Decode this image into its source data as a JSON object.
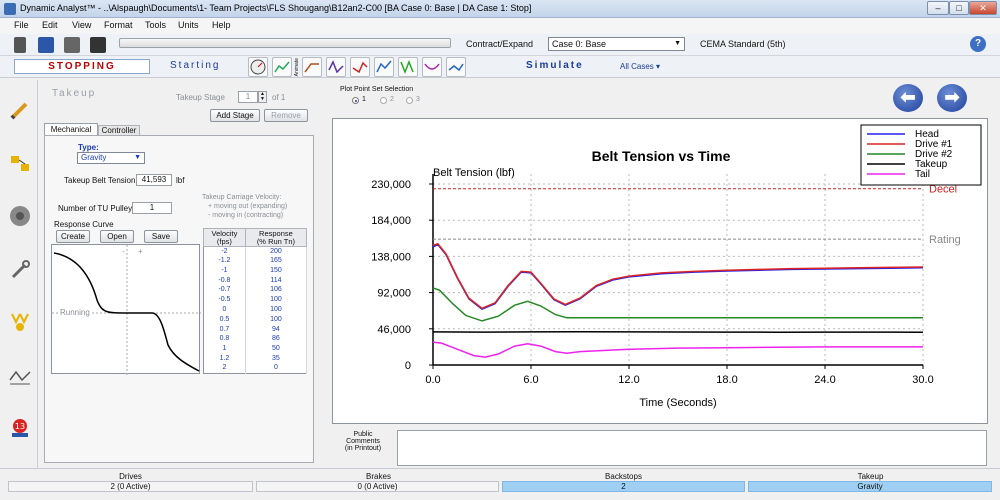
{
  "window": {
    "title": "Dynamic Analyst™ - ..\\Alspaugh\\Documents\\1- Team Projects\\FLS Shougang\\B12an2-C00 [BA Case 0: Base | DA Case 1: Stop]",
    "min": "–",
    "max": "□",
    "close": "✕"
  },
  "menu": [
    "File",
    "Edit",
    "View",
    "Format",
    "Tools",
    "Units",
    "Help"
  ],
  "toolbar": {
    "contract_expand": "Contract/Expand",
    "case_select": "Case 0: Base",
    "standard": "CEMA Standard (5th)",
    "help": "?"
  },
  "modebar": {
    "stopping": "STOPPING",
    "starting": "Starting",
    "simulate": "Simulate",
    "all_cases": "All Cases ▾",
    "tools": [
      "Animate",
      "Tension",
      "Speed",
      "Power",
      "Torque",
      "Slip",
      "Takeup",
      "Sag"
    ]
  },
  "takeup": {
    "title": "Takeup",
    "stage_label": "Takeup Stage",
    "stage_value": "1",
    "stage_of": "of 1",
    "add_stage": "Add Stage",
    "remove": "Remove",
    "tabs": [
      "Mechanical",
      "Controller"
    ],
    "type_label": "Type:",
    "type_value": "Gravity",
    "belt_tension_label": "Takeup Belt Tension",
    "belt_tension_value": "41,593",
    "belt_tension_unit": "lbf",
    "pulleys_label": "Number of TU Pulleys",
    "pulleys_value": "1",
    "carriage_title": "Takeup Carriage Velocity:",
    "carriage_plus": "+  moving out (expanding)",
    "carriage_minus": "-   moving in (contracting)",
    "response_curve": "Response Curve",
    "create": "Create",
    "open": "Open",
    "save": "Save",
    "curve_minus": "-",
    "curve_plus": "+",
    "running": "Running",
    "table_headers": [
      "Velocity\n(fps)",
      "Response\n(% Run Tn)"
    ],
    "table_rows": [
      [
        "-2",
        "200"
      ],
      [
        "-1.2",
        "165"
      ],
      [
        "-1",
        "150"
      ],
      [
        "-0.8",
        "114"
      ],
      [
        "-0.7",
        "106"
      ],
      [
        "-0.5",
        "100"
      ],
      [
        "0",
        "100"
      ],
      [
        "0.5",
        "100"
      ],
      [
        "0.7",
        "94"
      ],
      [
        "0.8",
        "86"
      ],
      [
        "1",
        "50"
      ],
      [
        "1.2",
        "35"
      ],
      [
        "2",
        "0"
      ]
    ]
  },
  "plotpoint": {
    "label": "Plot Point Set Selection",
    "options": [
      "1",
      "2",
      "3"
    ]
  },
  "comments": {
    "label": "Public Comments\n(in Printout)"
  },
  "status": [
    {
      "head": "Drives",
      "value": "2 (0 Active)"
    },
    {
      "head": "Brakes",
      "value": "0 (0 Active)"
    },
    {
      "head": "Backstops",
      "value": "2"
    },
    {
      "head": "Takeup",
      "value": "Gravity"
    }
  ],
  "chart_data": {
    "type": "line",
    "title": "Belt Tension vs Time",
    "ylabel": "Belt Tension (lbf)",
    "xlabel": "Time (Seconds)",
    "xlim": [
      0,
      30
    ],
    "ylim": [
      0,
      230000
    ],
    "xticks": [
      "0.0",
      "6.0",
      "12.0",
      "18.0",
      "24.0",
      "30.0"
    ],
    "yticks": [
      "0",
      "46,000",
      "92,000",
      "138,000",
      "184,000",
      "230,000"
    ],
    "grid": true,
    "legend": "top-right",
    "reference_lines": [
      {
        "name": "Decel",
        "y": 224000,
        "color": "#cc2222"
      },
      {
        "name": "Rating",
        "y": 160000,
        "color": "#888888"
      }
    ],
    "series": [
      {
        "name": "Head",
        "color": "#2222ee",
        "x": [
          0,
          0.3,
          0.8,
          1.5,
          2.2,
          3,
          3.8,
          4.6,
          5.4,
          6,
          6.6,
          7.4,
          8.1,
          9,
          10,
          11,
          12,
          14,
          16,
          18,
          20,
          22,
          24,
          26,
          28,
          30
        ],
        "y": [
          150000,
          153000,
          140000,
          110000,
          84000,
          71000,
          78000,
          100000,
          118000,
          117000,
          103000,
          83000,
          76000,
          84000,
          100000,
          108000,
          112000,
          116000,
          118000,
          119500,
          120500,
          121500,
          122000,
          122500,
          123000,
          123500
        ]
      },
      {
        "name": "Drive #1",
        "color": "#dd2222",
        "x": [
          0,
          0.3,
          0.8,
          1.5,
          2.2,
          3,
          3.8,
          4.6,
          5.4,
          6,
          6.6,
          7.4,
          8.1,
          9,
          10,
          11,
          12,
          14,
          16,
          18,
          20,
          22,
          24,
          26,
          28,
          30
        ],
        "y": [
          152000,
          154000,
          141000,
          111000,
          85000,
          72000,
          79000,
          101000,
          119000,
          118000,
          104000,
          84000,
          77000,
          85000,
          101000,
          109000,
          113000,
          117000,
          119000,
          120500,
          121500,
          122500,
          123000,
          123500,
          124000,
          124500
        ]
      },
      {
        "name": "Drive #2",
        "color": "#228822",
        "x": [
          0,
          0.4,
          1.2,
          2,
          3,
          4,
          5,
          5.8,
          6.6,
          7.5,
          8.2,
          9,
          12,
          15,
          18,
          21,
          24,
          27,
          30
        ],
        "y": [
          98000,
          95000,
          78000,
          63000,
          56000,
          62000,
          76000,
          81000,
          75000,
          64000,
          60000,
          60000,
          60000,
          60000,
          60000,
          60000,
          60000,
          60000,
          60000
        ]
      },
      {
        "name": "Takeup",
        "color": "#000000",
        "x": [
          0,
          3,
          6,
          9,
          12,
          15,
          18,
          21,
          24,
          27,
          30
        ],
        "y": [
          42000,
          41800,
          42000,
          42200,
          42000,
          41900,
          41800,
          41700,
          41800,
          41800,
          41700
        ]
      },
      {
        "name": "Tail",
        "color": "#ee22ee",
        "x": [
          0,
          0.5,
          1.5,
          2.5,
          3.2,
          4,
          5,
          5.8,
          6.6,
          7.5,
          8.2,
          9,
          12,
          15,
          18,
          21,
          24,
          27,
          30
        ],
        "y": [
          29000,
          28000,
          20000,
          12000,
          10000,
          14000,
          24000,
          27000,
          24000,
          17000,
          15000,
          17000,
          20000,
          21500,
          22000,
          22500,
          23000,
          23000,
          23000
        ]
      }
    ]
  }
}
